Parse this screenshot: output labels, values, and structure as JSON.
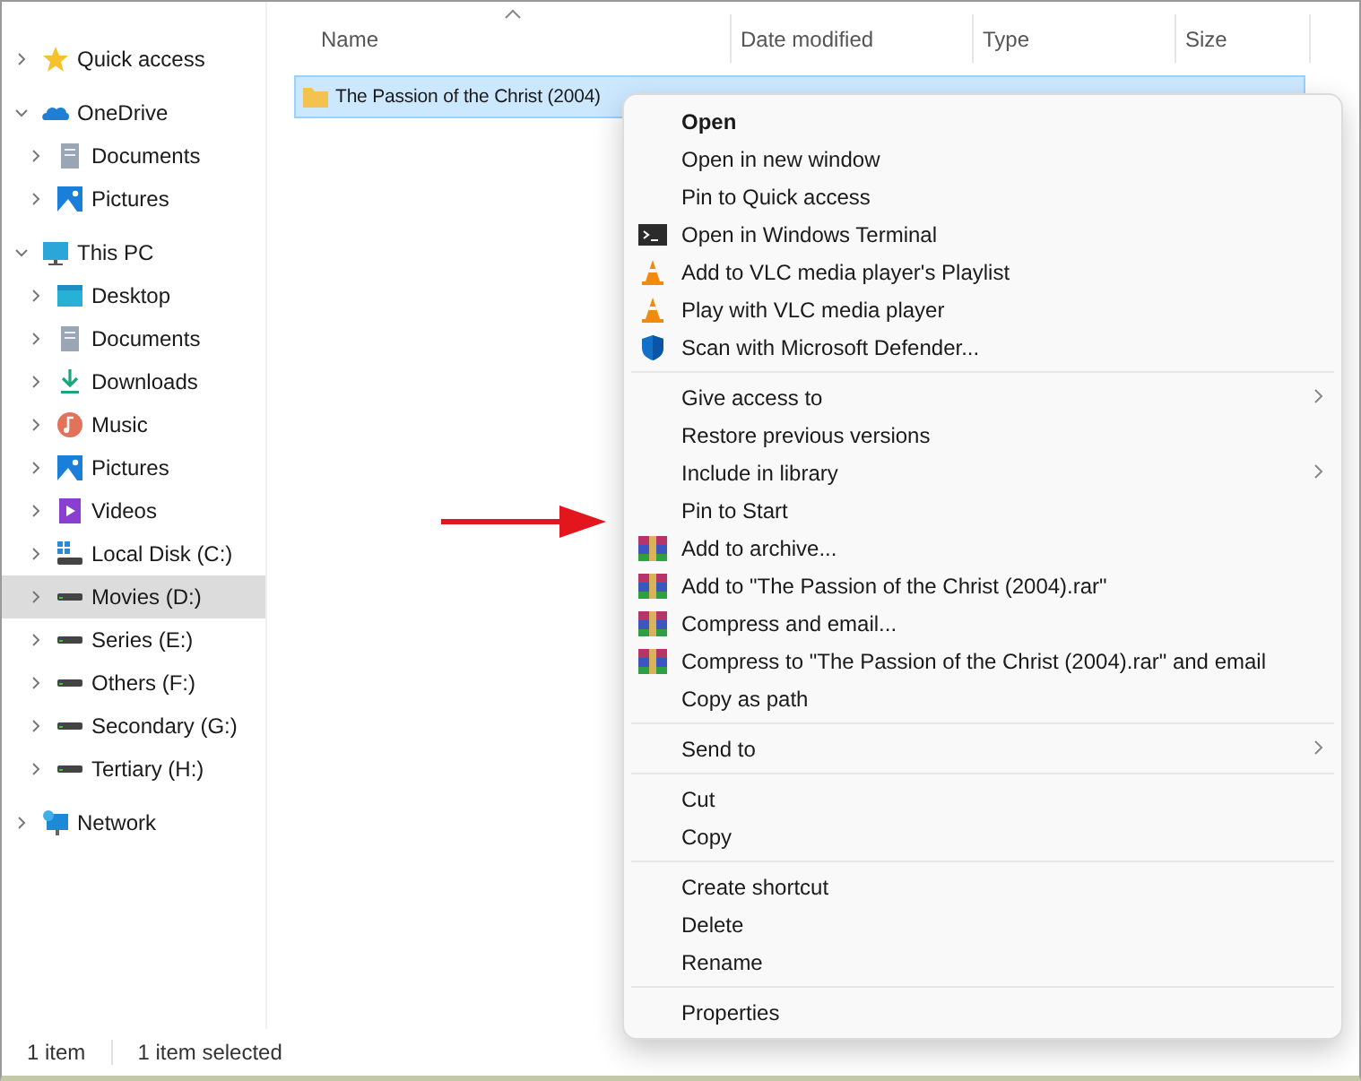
{
  "sidebar": {
    "items": [
      {
        "label": "Quick access",
        "kind": "star",
        "expanded": false,
        "selected": false
      },
      {
        "label": "OneDrive",
        "kind": "cloud",
        "expanded": true,
        "selected": false,
        "children": [
          {
            "label": "Documents",
            "kind": "document",
            "expanded": false,
            "selected": false
          },
          {
            "label": "Pictures",
            "kind": "picture",
            "expanded": false,
            "selected": false
          }
        ]
      },
      {
        "label": "This PC",
        "kind": "pc",
        "expanded": true,
        "selected": false,
        "children": [
          {
            "label": "Desktop",
            "kind": "desktop",
            "expanded": false,
            "selected": false
          },
          {
            "label": "Documents",
            "kind": "document",
            "expanded": false,
            "selected": false
          },
          {
            "label": "Downloads",
            "kind": "download",
            "expanded": false,
            "selected": false
          },
          {
            "label": "Music",
            "kind": "music",
            "expanded": false,
            "selected": false
          },
          {
            "label": "Pictures",
            "kind": "picture",
            "expanded": false,
            "selected": false
          },
          {
            "label": "Videos",
            "kind": "video",
            "expanded": false,
            "selected": false
          },
          {
            "label": "Local Disk (C:)",
            "kind": "system-drive",
            "expanded": false,
            "selected": false
          },
          {
            "label": "Movies (D:)",
            "kind": "drive",
            "expanded": false,
            "selected": true
          },
          {
            "label": "Series (E:)",
            "kind": "drive",
            "expanded": false,
            "selected": false
          },
          {
            "label": "Others (F:)",
            "kind": "drive",
            "expanded": false,
            "selected": false
          },
          {
            "label": "Secondary (G:)",
            "kind": "drive",
            "expanded": false,
            "selected": false
          },
          {
            "label": "Tertiary (H:)",
            "kind": "drive",
            "expanded": false,
            "selected": false
          }
        ]
      },
      {
        "label": "Network",
        "kind": "network",
        "expanded": false,
        "selected": false
      }
    ]
  },
  "file_list": {
    "columns": [
      {
        "label": "Name",
        "sorted": true
      },
      {
        "label": "Date modified",
        "sorted": false
      },
      {
        "label": "Type",
        "sorted": false
      },
      {
        "label": "Size",
        "sorted": false
      }
    ],
    "rows": [
      {
        "name": "The Passion of the Christ (2004)",
        "selected": true
      }
    ]
  },
  "context_menu": {
    "groups": [
      [
        {
          "label": "Open",
          "kind": "plain",
          "default": true,
          "submenu": false
        },
        {
          "label": "Open in new window",
          "kind": "plain",
          "default": false,
          "submenu": false
        },
        {
          "label": "Pin to Quick access",
          "kind": "plain",
          "default": false,
          "submenu": false
        },
        {
          "label": "Open in Windows Terminal",
          "kind": "terminal",
          "default": false,
          "submenu": false
        },
        {
          "label": "Add to VLC media player's Playlist",
          "kind": "vlc",
          "default": false,
          "submenu": false
        },
        {
          "label": "Play with VLC media player",
          "kind": "vlc",
          "default": false,
          "submenu": false
        },
        {
          "label": "Scan with Microsoft Defender...",
          "kind": "defender",
          "default": false,
          "submenu": false
        }
      ],
      [
        {
          "label": "Give access to",
          "kind": "plain",
          "default": false,
          "submenu": true
        },
        {
          "label": "Restore previous versions",
          "kind": "plain",
          "default": false,
          "submenu": false
        },
        {
          "label": "Include in library",
          "kind": "plain",
          "default": false,
          "submenu": true
        },
        {
          "label": "Pin to Start",
          "kind": "plain",
          "default": false,
          "submenu": false
        },
        {
          "label": "Add to archive...",
          "kind": "archive",
          "default": false,
          "submenu": false
        },
        {
          "label": "Add to \"The Passion of the Christ (2004).rar\"",
          "kind": "archive",
          "default": false,
          "submenu": false
        },
        {
          "label": "Compress and email...",
          "kind": "archive",
          "default": false,
          "submenu": false
        },
        {
          "label": "Compress to \"The Passion of the Christ (2004).rar\" and email",
          "kind": "archive",
          "default": false,
          "submenu": false
        },
        {
          "label": "Copy as path",
          "kind": "plain",
          "default": false,
          "submenu": false
        }
      ],
      [
        {
          "label": "Send to",
          "kind": "plain",
          "default": false,
          "submenu": true
        }
      ],
      [
        {
          "label": "Cut",
          "kind": "plain",
          "default": false,
          "submenu": false
        },
        {
          "label": "Copy",
          "kind": "plain",
          "default": false,
          "submenu": false
        }
      ],
      [
        {
          "label": "Create shortcut",
          "kind": "plain",
          "default": false,
          "submenu": false
        },
        {
          "label": "Delete",
          "kind": "plain",
          "default": false,
          "submenu": false
        },
        {
          "label": "Rename",
          "kind": "plain",
          "default": false,
          "submenu": false
        }
      ],
      [
        {
          "label": "Properties",
          "kind": "plain",
          "default": false,
          "submenu": false
        }
      ]
    ]
  },
  "status_bar": {
    "item_count": "1 item",
    "selection": "1 item selected"
  }
}
